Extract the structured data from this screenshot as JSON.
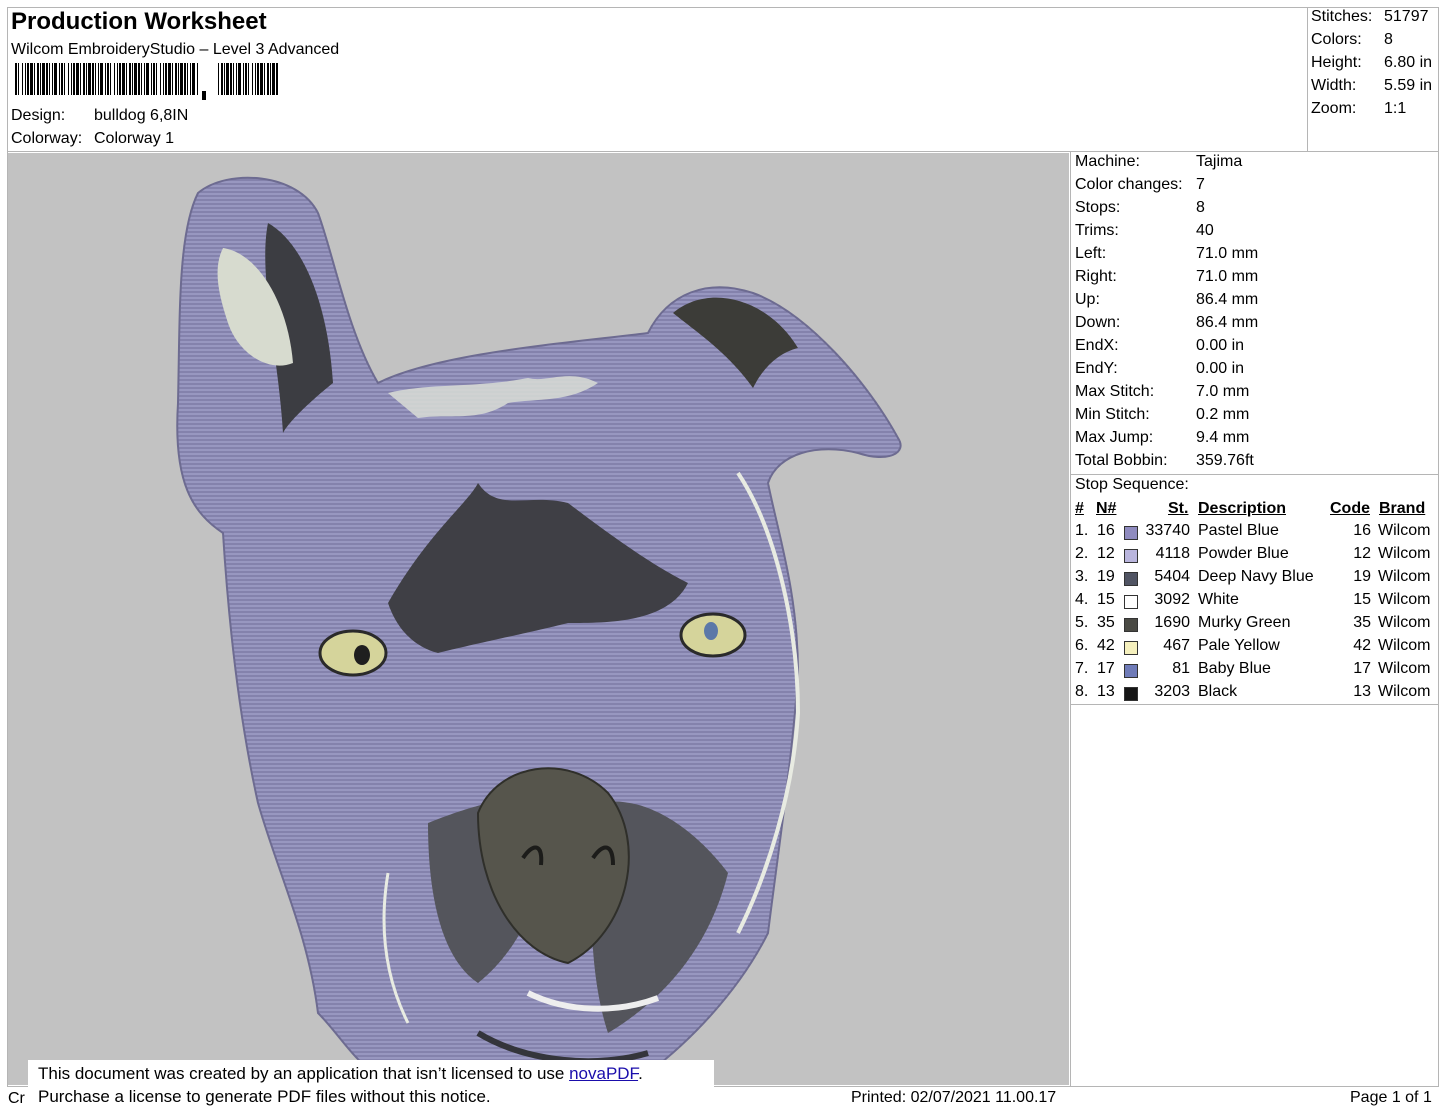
{
  "header": {
    "title": "Production Worksheet",
    "software": "Wilcom EmbroideryStudio – Level 3 Advanced",
    "design_label": "Design:",
    "design_value": "bulldog 6,8IN",
    "colorway_label": "Colorway:",
    "colorway_value": "Colorway 1"
  },
  "stats": [
    {
      "label": "Stitches:",
      "value": "51797"
    },
    {
      "label": "Colors:",
      "value": "8"
    },
    {
      "label": "Height:",
      "value": "6.80 in"
    },
    {
      "label": "Width:",
      "value": "5.59 in"
    },
    {
      "label": "Zoom:",
      "value": "1:1"
    }
  ],
  "machine_specs": [
    {
      "label": "Machine:",
      "value": "Tajima"
    },
    {
      "label": "Color changes:",
      "value": "7"
    },
    {
      "label": "Stops:",
      "value": "8"
    },
    {
      "label": "Trims:",
      "value": "40"
    },
    {
      "label": "Left:",
      "value": "71.0 mm"
    },
    {
      "label": "Right:",
      "value": "71.0 mm"
    },
    {
      "label": "Up:",
      "value": "86.4 mm"
    },
    {
      "label": "Down:",
      "value": "86.4 mm"
    },
    {
      "label": "EndX:",
      "value": "0.00 in"
    },
    {
      "label": "EndY:",
      "value": "0.00 in"
    },
    {
      "label": "Max Stitch:",
      "value": "7.0 mm"
    },
    {
      "label": "Min Stitch:",
      "value": "0.2 mm"
    },
    {
      "label": "Max Jump:",
      "value": "9.4 mm"
    },
    {
      "label": "Total Bobbin:",
      "value": "359.76ft"
    }
  ],
  "stop_sequence": {
    "title": "Stop Sequence:",
    "headers": {
      "num": "#",
      "needle": "N#",
      "stitches": "St.",
      "description": "Description",
      "code": "Code",
      "brand": "Brand"
    },
    "rows": [
      {
        "num": "1.",
        "needle": "16",
        "color": "#8f8bbf",
        "stitches": "33740",
        "description": "Pastel Blue",
        "code": "16",
        "brand": "Wilcom"
      },
      {
        "num": "2.",
        "needle": "12",
        "color": "#b9b5dd",
        "stitches": "4118",
        "description": "Powder Blue",
        "code": "12",
        "brand": "Wilcom"
      },
      {
        "num": "3.",
        "needle": "19",
        "color": "#505463",
        "stitches": "5404",
        "description": "Deep Navy Blue",
        "code": "19",
        "brand": "Wilcom"
      },
      {
        "num": "4.",
        "needle": "15",
        "color": "#ffffff",
        "stitches": "3092",
        "description": "White",
        "code": "15",
        "brand": "Wilcom"
      },
      {
        "num": "5.",
        "needle": "35",
        "color": "#4a4a44",
        "stitches": "1690",
        "description": "Murky Green",
        "code": "35",
        "brand": "Wilcom"
      },
      {
        "num": "6.",
        "needle": "42",
        "color": "#f5f0bd",
        "stitches": "467",
        "description": "Pale Yellow",
        "code": "42",
        "brand": "Wilcom"
      },
      {
        "num": "7.",
        "needle": "17",
        "color": "#6f7bb8",
        "stitches": "81",
        "description": "Baby Blue",
        "code": "17",
        "brand": "Wilcom"
      },
      {
        "num": "8.",
        "needle": "13",
        "color": "#151515",
        "stitches": "3203",
        "description": "Black",
        "code": "13",
        "brand": "Wilcom"
      }
    ]
  },
  "footer": {
    "created_prefix": "Cr",
    "notice_line1_prefix": "This document was created by an application that isn’t licensed to use ",
    "notice_link": "novaPDF",
    "notice_line1_suffix": ".",
    "notice_line2": "Purchase a license to generate PDF files without this notice.",
    "printed": "Printed: 02/07/2021 11.00.17",
    "page": "Page 1 of 1"
  }
}
